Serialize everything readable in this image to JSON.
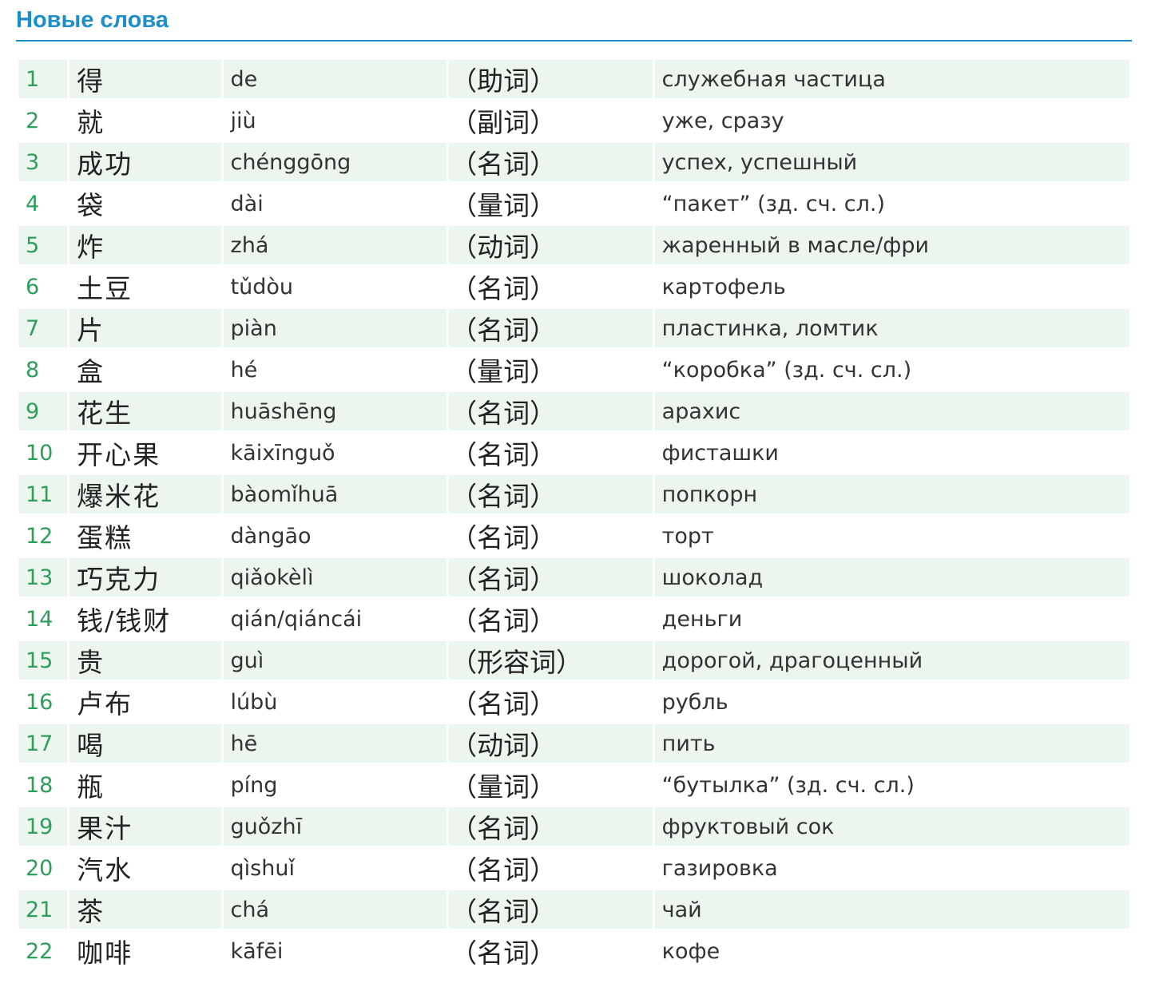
{
  "title": "Новые слова",
  "colors": {
    "accent": "#1e8fc8",
    "number": "#2e9e5b",
    "row_shade": "#ecf5ee"
  },
  "words": [
    {
      "num": "1",
      "hanzi": "得",
      "pinyin": "de",
      "pos": "（助词）",
      "meaning": "служебная частица"
    },
    {
      "num": "2",
      "hanzi": "就",
      "pinyin": "jiù",
      "pos": "（副词）",
      "meaning": "уже, сразу"
    },
    {
      "num": "3",
      "hanzi": "成功",
      "pinyin": "chénggōng",
      "pos": "（名词）",
      "meaning": "успех, успешный"
    },
    {
      "num": "4",
      "hanzi": "袋",
      "pinyin": "dài",
      "pos": "（量词）",
      "meaning": "“пакет” (зд. сч. сл.)"
    },
    {
      "num": "5",
      "hanzi": "炸",
      "pinyin": "zhá",
      "pos": "（动词）",
      "meaning": "жаренный в масле/фри"
    },
    {
      "num": "6",
      "hanzi": "土豆",
      "pinyin": "tǔdòu",
      "pos": "（名词）",
      "meaning": "картофель"
    },
    {
      "num": "7",
      "hanzi": "片",
      "pinyin": "piàn",
      "pos": "（名词）",
      "meaning": "пластинка, ломтик"
    },
    {
      "num": "8",
      "hanzi": "盒",
      "pinyin": "hé",
      "pos": "（量词）",
      "meaning": "“коробка” (зд. сч. сл.)"
    },
    {
      "num": "9",
      "hanzi": "花生",
      "pinyin": "huāshēng",
      "pos": "（名词）",
      "meaning": "арахис"
    },
    {
      "num": "10",
      "hanzi": "开心果",
      "pinyin": "kāixīnguǒ",
      "pos": "（名词）",
      "meaning": "фисташки"
    },
    {
      "num": "11",
      "hanzi": "爆米花",
      "pinyin": "bàomǐhuā",
      "pos": "（名词）",
      "meaning": "попкорн"
    },
    {
      "num": "12",
      "hanzi": "蛋糕",
      "pinyin": "dàngāo",
      "pos": "（名词）",
      "meaning": "торт"
    },
    {
      "num": "13",
      "hanzi": "巧克力",
      "pinyin": "qiǎokèlì",
      "pos": "（名词）",
      "meaning": "шоколад"
    },
    {
      "num": "14",
      "hanzi": "钱/钱财",
      "pinyin": "qián/qiáncái",
      "pos": "（名词）",
      "meaning": "деньги"
    },
    {
      "num": "15",
      "hanzi": "贵",
      "pinyin": "guì",
      "pos": "（形容词）",
      "meaning": "дорогой, драгоценный"
    },
    {
      "num": "16",
      "hanzi": "卢布",
      "pinyin": "lúbù",
      "pos": "（名词）",
      "meaning": "рубль"
    },
    {
      "num": "17",
      "hanzi": "喝",
      "pinyin": "hē",
      "pos": "（动词）",
      "meaning": "пить"
    },
    {
      "num": "18",
      "hanzi": "瓶",
      "pinyin": "píng",
      "pos": "（量词）",
      "meaning": "“бутылка” (зд. сч. сл.)"
    },
    {
      "num": "19",
      "hanzi": "果汁",
      "pinyin": "guǒzhī",
      "pos": "（名词）",
      "meaning": "фруктовый сок"
    },
    {
      "num": "20",
      "hanzi": "汽水",
      "pinyin": "qìshuǐ",
      "pos": "（名词）",
      "meaning": "газировка"
    },
    {
      "num": "21",
      "hanzi": "茶",
      "pinyin": "chá",
      "pos": "（名词）",
      "meaning": "чай"
    },
    {
      "num": "22",
      "hanzi": "咖啡",
      "pinyin": "kāfēi",
      "pos": "（名词）",
      "meaning": "кофе"
    }
  ]
}
